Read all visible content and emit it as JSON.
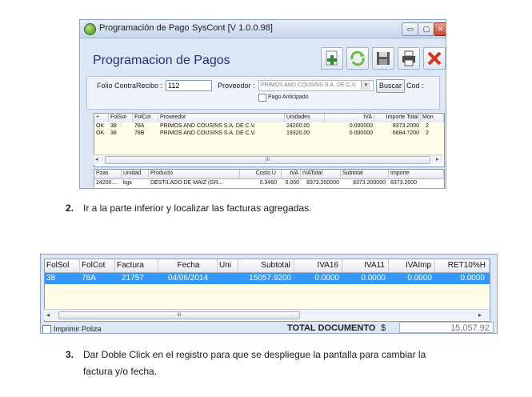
{
  "screen1": {
    "window_title": "Programación de Pago",
    "app_name": "SysCont [V 1.0.0.98]",
    "window_controls": {
      "minimize": "▭",
      "maximize": "▢",
      "close": "✕"
    },
    "heading": "Programacion de Pagos",
    "toolbar": [
      {
        "name": "new-icon",
        "color": "#2e8b2e"
      },
      {
        "name": "refresh-icon",
        "color": "#6cbb3c"
      },
      {
        "name": "save-icon",
        "color": "#4b4b4b"
      },
      {
        "name": "print-icon",
        "color": "#4b4b4b"
      },
      {
        "name": "close-icon",
        "color": "#d93020"
      }
    ],
    "form": {
      "folio_label": "Folio ContraRecibo :",
      "folio_value": "112",
      "proveedor_label": "Proveedor :",
      "proveedor_value": "PRIMOS AND COUSINS S.A. DE C.V.",
      "search_label": "Buscar",
      "cod_label": "Cod :",
      "pago_anticipado_label": "Pago Anticipado"
    },
    "grid1": {
      "columns": [
        "+",
        "FolSol",
        "FolCot",
        "Proveedor",
        "Unidades",
        "IVA",
        "Importe Total",
        "Mon"
      ],
      "rows": [
        [
          "OK",
          "38",
          "78A",
          "PRIMOS AND COUSINS S.A. DE C.V.",
          "24200.00",
          "0.000000",
          "8373.2000",
          "2"
        ],
        [
          "OK",
          "38",
          "78B",
          "PRIMOS AND COUSINS S.A. DE C.V.",
          "19320.00",
          "0.000000",
          "6684.7200",
          "2"
        ]
      ],
      "scroll_left": "◂",
      "scroll_right": "▸",
      "scroll_thumb": "III"
    },
    "grid2": {
      "columns": [
        "Pzas",
        "Unidad",
        "Producto",
        "Costo U",
        "IVA",
        "IVATotal",
        "Subtotal",
        "Importe"
      ],
      "rows": [
        [
          "24200....",
          "kgs",
          "DESTILADO DE MAIZ (GR...",
          "0.3460",
          "0.000",
          "8373.200000",
          "8373.200000",
          "8373.2000"
        ]
      ]
    }
  },
  "step2": {
    "number": "2.",
    "text": "Ir a la parte inferior y localizar las facturas agregadas."
  },
  "screen2": {
    "columns": [
      "FolSol",
      "FolCot",
      "Factura",
      "Fecha",
      "Uni",
      "Subtotal",
      "IVA16",
      "IVA11",
      "IVAImp",
      "RET10%H"
    ],
    "row": [
      "38",
      "78A",
      "21757",
      "04/06/2014",
      "",
      "15057.9200",
      "0.0000",
      "0.0000",
      "0.0000",
      "0.0000"
    ],
    "selected_row_color": "#3399ff",
    "scroll_left": "◂",
    "scroll_right": "▸",
    "scroll_thumb": "III",
    "imprimir_label": "Imprimir Poliza",
    "total_label": "TOTAL DOCUMENTO",
    "currency": "$",
    "total_value": "15,057.92"
  },
  "step3": {
    "number": "3.",
    "text_line1": "Dar Doble Click  en el registro para que se despliegue la pantalla para cambiar la",
    "text_line2": "factura y/o fecha."
  }
}
